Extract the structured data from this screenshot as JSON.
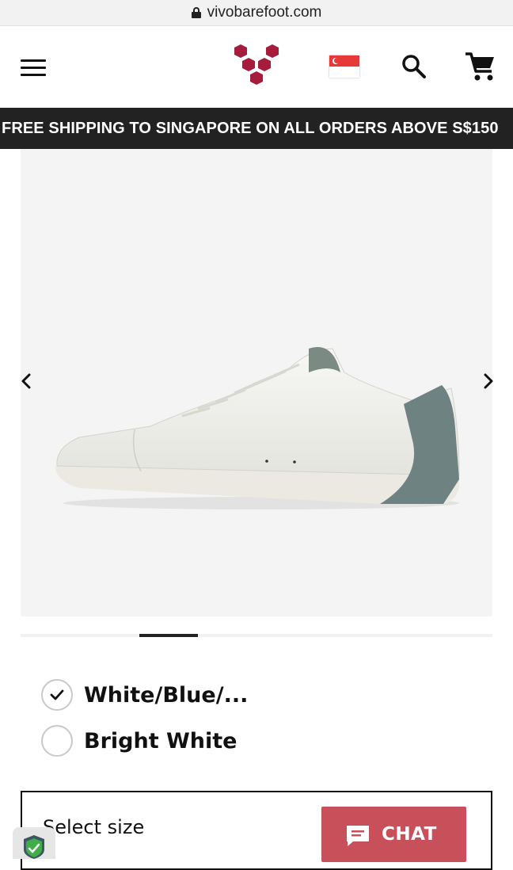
{
  "browser": {
    "url": "vivobarefoot.com"
  },
  "header": {
    "menu_icon": "hamburger-icon",
    "logo_icon": "vivobarefoot-logo",
    "flag_icon": "singapore-flag-icon",
    "search_icon": "search-icon",
    "cart_icon": "cart-icon"
  },
  "banner": {
    "text": "FREE SHIPPING TO SINGAPORE ON ALL ORDERS ABOVE S$150"
  },
  "gallery": {
    "prev_icon": "chevron-left-icon",
    "next_icon": "chevron-right-icon",
    "image_icon": "white-sneaker-image"
  },
  "colors": {
    "options": [
      {
        "label": "White/Blue/...",
        "selected": true
      },
      {
        "label": "Bright White",
        "selected": false
      }
    ]
  },
  "size": {
    "label": "Select size"
  },
  "chat": {
    "label": "CHAT",
    "icon": "chat-bubble-icon"
  },
  "theme": {
    "banner_bg": "#222222",
    "chat_bg": "#c8505a",
    "logo_color": "#a51c3c"
  }
}
